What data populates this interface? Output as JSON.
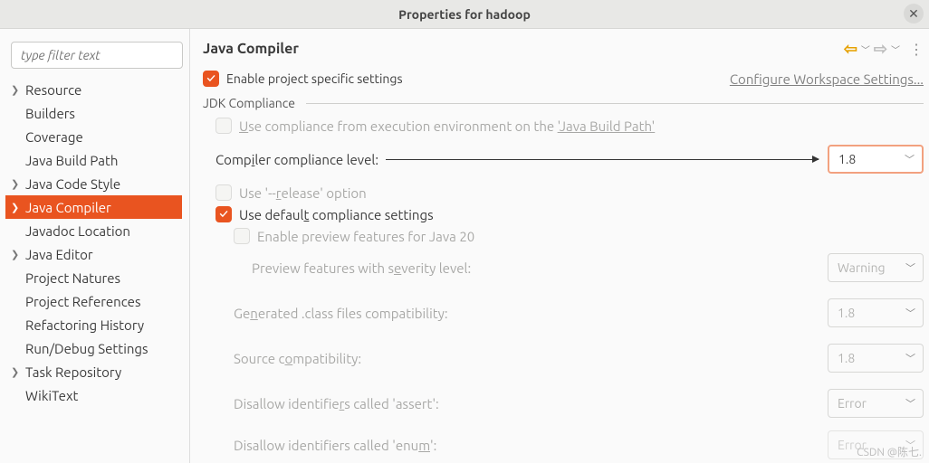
{
  "window": {
    "title": "Properties for hadoop"
  },
  "filter": {
    "placeholder": "type filter text"
  },
  "sidebar": {
    "items": [
      {
        "label": "Resource",
        "expandable": true
      },
      {
        "label": "Builders",
        "expandable": false
      },
      {
        "label": "Coverage",
        "expandable": false
      },
      {
        "label": "Java Build Path",
        "expandable": false
      },
      {
        "label": "Java Code Style",
        "expandable": true
      },
      {
        "label": "Java Compiler",
        "expandable": true,
        "selected": true
      },
      {
        "label": "Javadoc Location",
        "expandable": false
      },
      {
        "label": "Java Editor",
        "expandable": true
      },
      {
        "label": "Project Natures",
        "expandable": false
      },
      {
        "label": "Project References",
        "expandable": false
      },
      {
        "label": "Refactoring History",
        "expandable": false
      },
      {
        "label": "Run/Debug Settings",
        "expandable": false
      },
      {
        "label": "Task Repository",
        "expandable": true
      },
      {
        "label": "WikiText",
        "expandable": false
      }
    ]
  },
  "main": {
    "title": "Java Compiler",
    "enable_label_pre": "Enable pro",
    "enable_label_u": "j",
    "enable_label_post": "ect specific settings",
    "workspace_link": "Configure Workspace Settings...",
    "group_title": "JDK Compliance",
    "use_env_pre": "U",
    "use_env_post": "se compliance from execution environment on the ",
    "use_env_link": "'Java Build Path'",
    "level_label_pre": "Comp",
    "level_label_u": "i",
    "level_label_post": "ler compliance level:",
    "level_value": "1.8",
    "release_pre": "Use '--",
    "release_u": "r",
    "release_post": "elease' option",
    "defaults_pre": "Use defaul",
    "defaults_u": "t",
    "defaults_post": " compliance settings",
    "preview_enable": "Enable preview features for Java 20",
    "preview_sev_pre": "Preview features with s",
    "preview_sev_u": "e",
    "preview_sev_post": "verity level:",
    "preview_sev_value": "Warning",
    "gen_pre": "Ge",
    "gen_u": "n",
    "gen_post": "erated .class files compatibility:",
    "gen_value": "1.8",
    "src_pre": "Source c",
    "src_u": "o",
    "src_post": "mpatibility:",
    "src_value": "1.8",
    "assert_pre": "Disallow identifie",
    "assert_u": "r",
    "assert_post": "s called 'assert':",
    "assert_value": "Error",
    "enum_pre": "Disallow identifiers called 'enu",
    "enum_u": "m",
    "enum_post": "':",
    "enum_value": "Error"
  },
  "watermark": "CSDN @陈七."
}
